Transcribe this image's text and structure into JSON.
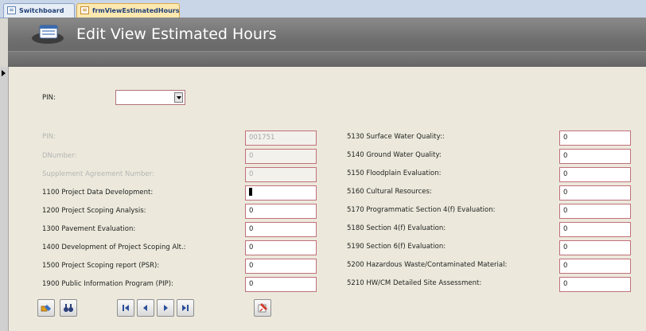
{
  "tabs": [
    {
      "label": "Switchboard"
    },
    {
      "label": "frmViewEstimatedHours"
    }
  ],
  "header": {
    "title": "Edit View Estimated Hours"
  },
  "pin_selector": {
    "label": "PIN:",
    "value": ""
  },
  "left_fields": [
    {
      "label": "PIN:",
      "value": "001751"
    },
    {
      "label": "DNumber:",
      "value": "0"
    },
    {
      "label": "Supplement Agreement Number:",
      "value": "0"
    },
    {
      "label": "1100 Project Data Development:",
      "value": ""
    },
    {
      "label": "1200 Project Scoping Analysis:",
      "value": "0"
    },
    {
      "label": "1300 Pavement Evaluation:",
      "value": "0"
    },
    {
      "label": "1400 Development of Project Scoping Alt.:",
      "value": "0"
    },
    {
      "label": "1500 Project Scoping report (PSR):",
      "value": "0"
    },
    {
      "label": "1900 Public Information Program (PIP):",
      "value": "0"
    }
  ],
  "right_fields": [
    {
      "label": "5130 Surface Water Quality::",
      "value": "0"
    },
    {
      "label": "5140 Ground Water Quality:",
      "value": "0"
    },
    {
      "label": "5150 Floodplain Evaluation:",
      "value": "0"
    },
    {
      "label": "5160 Cultural Resources:",
      "value": "0"
    },
    {
      "label": "5170 Programmatic Section 4(f) Evaluation:",
      "value": "0"
    },
    {
      "label": "5180 Section 4(f) Evaluation:",
      "value": "0"
    },
    {
      "label": "5190 Section 6(f) Evaluation:",
      "value": "0"
    },
    {
      "label": "5200 Hazardous Waste/Contaminated Material:",
      "value": "0"
    },
    {
      "label": "5210 HW/CM Detailed Site Assessment:",
      "value": "0"
    }
  ],
  "colors": {
    "field_border": "#c0707a",
    "header_bg": "#6f6f6f",
    "form_bg": "#ece9dc",
    "tab_active": "#fde9b0"
  },
  "icons": [
    "form-icon",
    "edit-record-icon",
    "find-binoculars-icon",
    "first-record-icon",
    "previous-record-icon",
    "next-record-icon",
    "last-record-icon",
    "close-form-icon"
  ]
}
